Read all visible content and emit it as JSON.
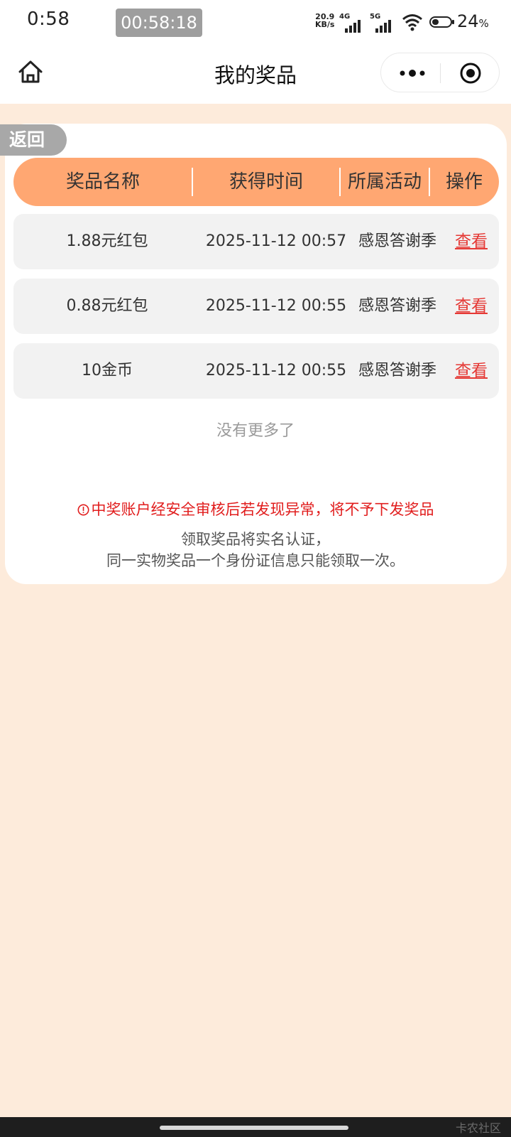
{
  "status_bar": {
    "time": "0:58",
    "timer": "00:58:18",
    "net_speed_value": "20.9",
    "net_speed_unit": "KB/s",
    "signal_1_label": "4G",
    "signal_2_label": "5G",
    "battery_value": "24",
    "battery_unit": "%"
  },
  "nav": {
    "title": "我的奖品",
    "home_icon": "home-icon",
    "more_icon": "more-icon",
    "close_icon": "close-icon"
  },
  "back_label": "返回",
  "table": {
    "headers": [
      "奖品名称",
      "获得时间",
      "所属活动",
      "操作"
    ],
    "rows": [
      {
        "name": "1.88元红包",
        "time": "2025-11-12 00:57",
        "activity": "感恩答谢季",
        "action": "查看"
      },
      {
        "name": "0.88元红包",
        "time": "2025-11-12 00:55",
        "activity": "感恩答谢季",
        "action": "查看"
      },
      {
        "name": "10金币",
        "time": "2025-11-12 00:55",
        "activity": "感恩答谢季",
        "action": "查看"
      }
    ]
  },
  "no_more": "没有更多了",
  "warning": "中奖账户经安全审核后若发现异常，将不予下发奖品",
  "notice_line1": "领取奖品将实名认证，",
  "notice_line2": "同一实物奖品一个身份证信息只能领取一次。",
  "watermark": "卡农社区",
  "colors": {
    "page_bg": "#FDEBDB",
    "header_orange": "#FFA772",
    "link_red": "#E53935",
    "warning_red": "#E11D1D",
    "row_bg": "#F2F2F2"
  }
}
